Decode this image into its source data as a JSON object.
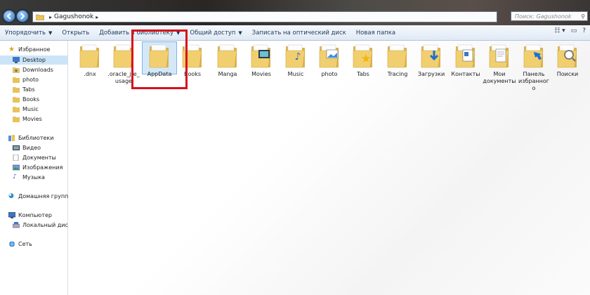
{
  "address": {
    "path_segment": "Gagushonok",
    "search_placeholder": "Поиск: Gagushonok"
  },
  "toolbar": {
    "items": [
      "Упорядочить",
      "Открыть",
      "Добавить в библиотеку",
      "Общий доступ",
      "Записать на оптический диск",
      "Новая папка"
    ]
  },
  "sidebar": {
    "favorites_header": "Избранное",
    "favorites": [
      "Desktop",
      "Downloads",
      "photo",
      "Tabs",
      "Books",
      "Music",
      "Movies"
    ],
    "libraries_header": "Библиотеки",
    "libraries": [
      "Видео",
      "Документы",
      "Изображения",
      "Музыка"
    ],
    "homegroup": "Домашняя группа",
    "computer_header": "Компьютер",
    "computer_items": [
      "Локальный диск"
    ],
    "network": "Сеть"
  },
  "files": [
    {
      "label": ".dnx",
      "icon": "folder-icon"
    },
    {
      "label": ".oracle_jre_usage",
      "icon": "folder-icon"
    },
    {
      "label": "AppData",
      "icon": "folder-icon"
    },
    {
      "label": "Books",
      "icon": "folder-icon"
    },
    {
      "label": "Manga",
      "icon": "folder-icon"
    },
    {
      "label": "Movies",
      "icon": "movie-folder-icon"
    },
    {
      "label": "Music",
      "icon": "music-folder-icon"
    },
    {
      "label": "photo",
      "icon": "photo-folder-icon"
    },
    {
      "label": "Tabs",
      "icon": "star-folder-icon"
    },
    {
      "label": "Tracing",
      "icon": "folder-icon"
    },
    {
      "label": "Загрузки",
      "icon": "downloads-folder-icon"
    },
    {
      "label": "Контакты",
      "icon": "contacts-folder-icon"
    },
    {
      "label": "Мои документы",
      "icon": "documents-folder-icon"
    },
    {
      "label": "Панель избранного",
      "icon": "favorites-folder-icon"
    },
    {
      "label": "Поиски",
      "icon": "search-folder-icon"
    }
  ],
  "colors": {
    "highlight": "#d6111b",
    "folder": "#f2cf6e",
    "selection": "#cce4f7"
  }
}
